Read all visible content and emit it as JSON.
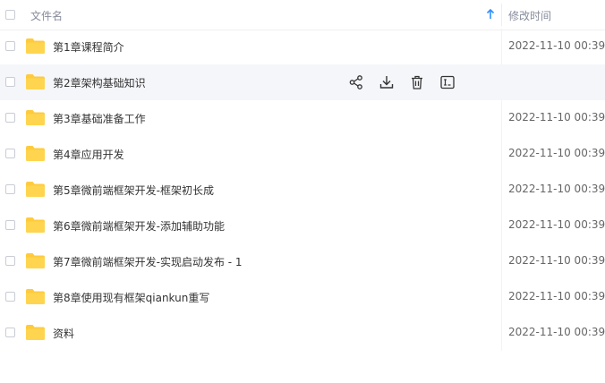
{
  "header": {
    "name_label": "文件名",
    "time_label": "修改时间",
    "sort_icon": "arrow-up-icon",
    "sort_color": "#2e8fff"
  },
  "folder_color": "#ffcb3d",
  "rows": [
    {
      "name": "第1章课程简介",
      "time": "2022-11-10 00:39"
    },
    {
      "name": "第2章架构基础知识",
      "time": ""
    },
    {
      "name": "第3章基础准备工作",
      "time": "2022-11-10 00:39"
    },
    {
      "name": "第4章应用开发",
      "time": "2022-11-10 00:39"
    },
    {
      "name": "第5章微前端框架开发-框架初长成",
      "time": "2022-11-10 00:39"
    },
    {
      "name": "第6章微前端框架开发-添加辅助功能",
      "time": "2022-11-10 00:39"
    },
    {
      "name": "第7章微前端框架开发-实现启动发布 - 1",
      "time": "2022-11-10 00:39"
    },
    {
      "name": "第8章使用现有框架qiankun重写",
      "time": "2022-11-10 00:39"
    },
    {
      "name": "资料",
      "time": "2022-11-10 00:39"
    }
  ],
  "hover_actions": [
    "share-icon",
    "download-icon",
    "delete-icon",
    "rename-icon"
  ]
}
